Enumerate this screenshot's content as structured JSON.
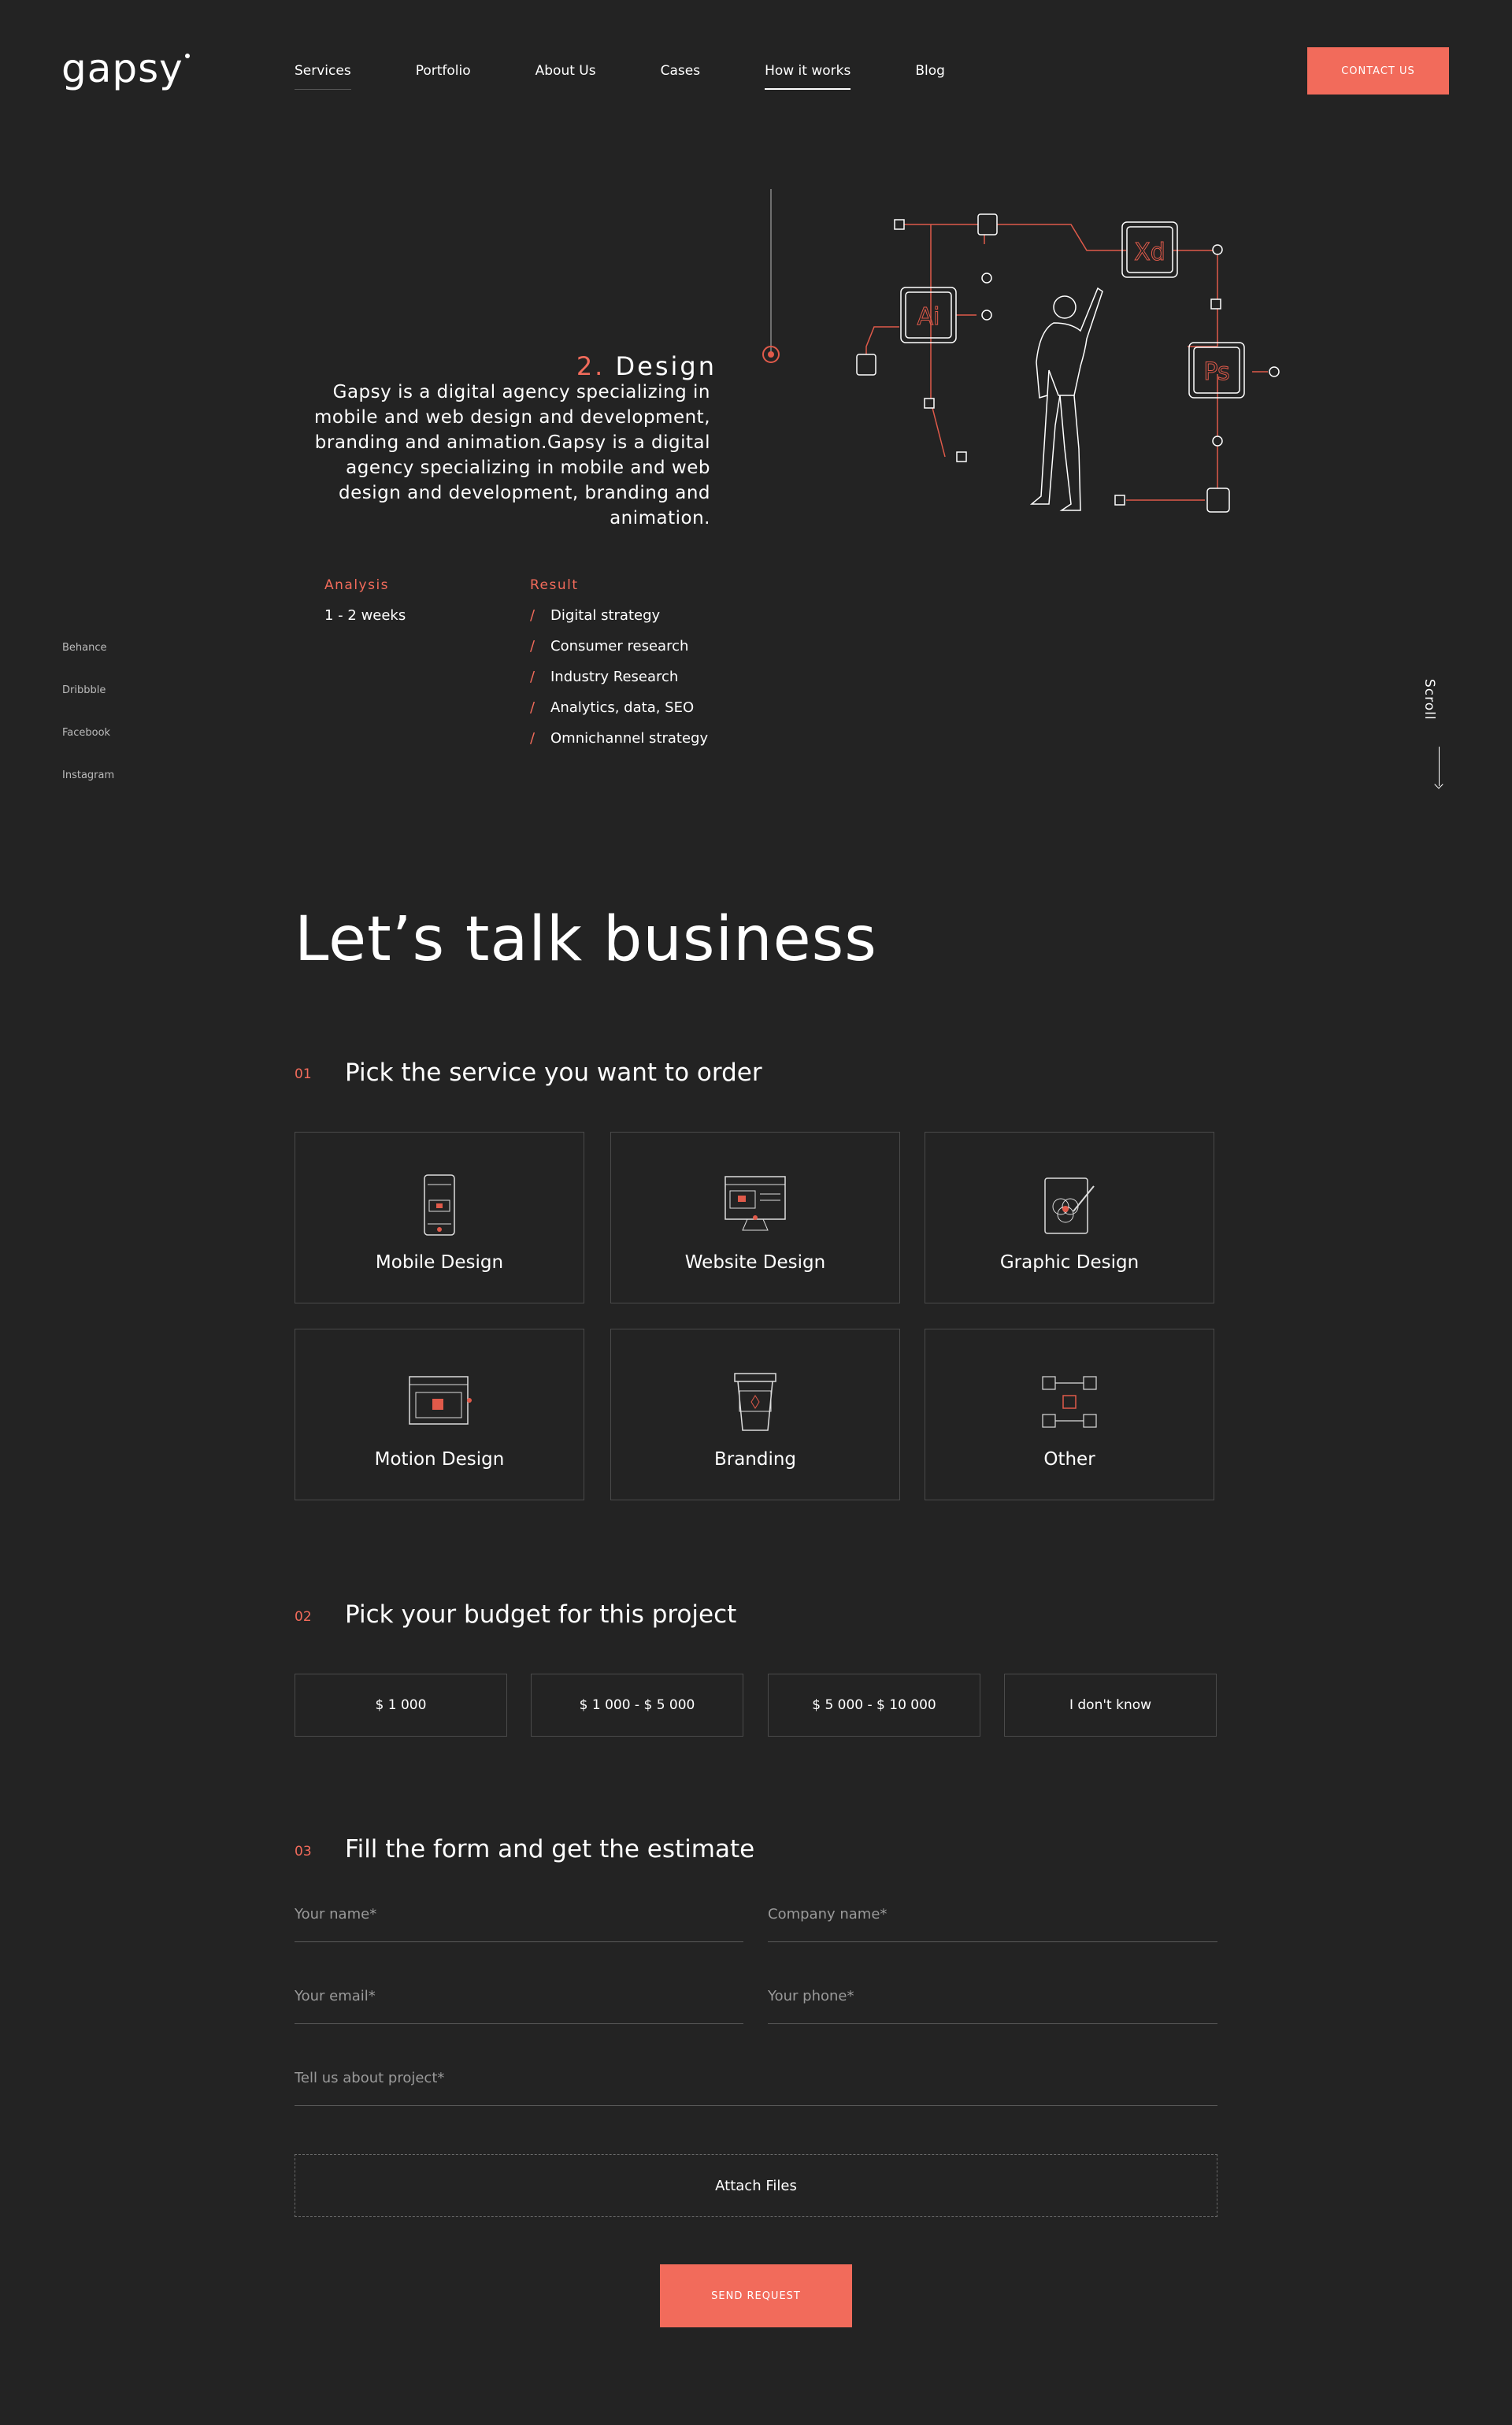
{
  "brand": {
    "logo": "gapsy"
  },
  "nav": {
    "items": [
      "Services",
      "Portfolio",
      "About Us",
      "Cases",
      "How it works",
      "Blog"
    ],
    "contact_label": "CONTACT US"
  },
  "step": {
    "number": "2.",
    "title": "Design",
    "description": "Gapsy is a digital agency specializing in mobile and web design and development, branding and animation.Gapsy is a digital agency specializing in mobile and web design and development, branding and animation.",
    "analysis_label": "Analysis",
    "analysis_value": "1 - 2 weeks",
    "result_label": "Result",
    "results": [
      "Digital strategy",
      "Consumer research",
      "Industry Research",
      "Analytics, data, SEO",
      "Omnichannel strategy"
    ],
    "illustration_icons": [
      "Ai",
      "Xd",
      "Ps"
    ]
  },
  "social": [
    "Behance",
    "Dribbble",
    "Facebook",
    "Instagram"
  ],
  "scroll_label": "Scroll",
  "business": {
    "title": "Let’s talk business",
    "step1": {
      "num": "01",
      "title": "Pick the service you want to order"
    },
    "services": [
      "Mobile Design",
      "Website Design",
      "Graphic Design",
      "Motion Design",
      "Branding",
      "Other"
    ],
    "step2": {
      "num": "02",
      "title": "Pick your budget for this project"
    },
    "budgets": [
      "$ 1 000",
      "$ 1 000 - $ 5 000",
      "$ 5 000 - $ 10 000",
      "I don't know"
    ],
    "step3": {
      "num": "03",
      "title": "Fill the form and get the estimate"
    },
    "form": {
      "name_placeholder": "Your name*",
      "company_placeholder": "Company name*",
      "email_placeholder": "Your email*",
      "phone_placeholder": "Your phone*",
      "project_placeholder": "Tell us about project*",
      "attach_label": "Attach Files",
      "send_label": "SEND REQUEST"
    }
  },
  "colors": {
    "background": "#232323",
    "accent": "#f26b5b",
    "text": "#ffffff"
  }
}
